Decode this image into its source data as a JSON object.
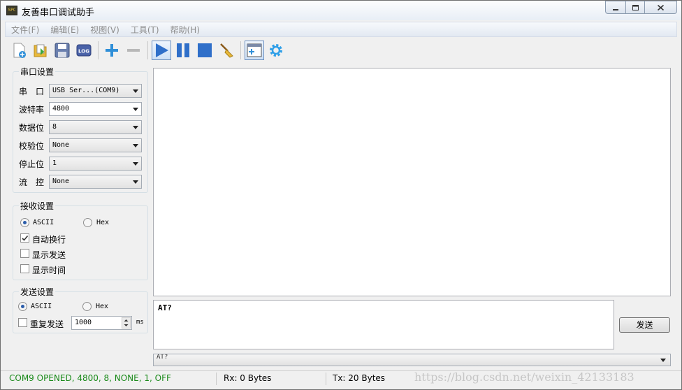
{
  "window": {
    "title": "友善串口调试助手",
    "app_icon_text": "SPC"
  },
  "menu": [
    "文件(F)",
    "编辑(E)",
    "视图(V)",
    "工具(T)",
    "帮助(H)"
  ],
  "serial_settings": {
    "title": "串口设置",
    "port_label": "串　口",
    "port_value": "USB Ser...(COM9)",
    "baud_label": "波特率",
    "baud_value": "4800",
    "databits_label": "数据位",
    "databits_value": "8",
    "parity_label": "校验位",
    "parity_value": "None",
    "stopbits_label": "停止位",
    "stopbits_value": "1",
    "flow_label": "流　控",
    "flow_value": "None"
  },
  "receive_settings": {
    "title": "接收设置",
    "ascii_label": "ASCII",
    "hex_label": "Hex",
    "mode_selected": "ASCII",
    "auto_wrap_label": "自动换行",
    "auto_wrap_checked": true,
    "show_send_label": "显示发送",
    "show_send_checked": false,
    "show_time_label": "显示时间",
    "show_time_checked": false
  },
  "send_settings": {
    "title": "发送设置",
    "ascii_label": "ASCII",
    "hex_label": "Hex",
    "mode_selected": "ASCII",
    "repeat_label": "重复发送",
    "repeat_checked": false,
    "interval_value": "1000",
    "interval_unit": "ms"
  },
  "send_text": "AT?",
  "send_button_label": "发送",
  "history_value": "AT?",
  "status": {
    "connection": "COM9 OPENED, 4800, 8, NONE, 1, OFF",
    "connection_color": "#1a8a1a",
    "rx": "Rx: 0 Bytes",
    "tx": "Tx: 20 Bytes"
  },
  "watermark": "https://blog.csdn.net/weixin_42133183",
  "colors": {
    "accent_blue": "#2f6fc9",
    "status_green": "#1a8a1a"
  }
}
